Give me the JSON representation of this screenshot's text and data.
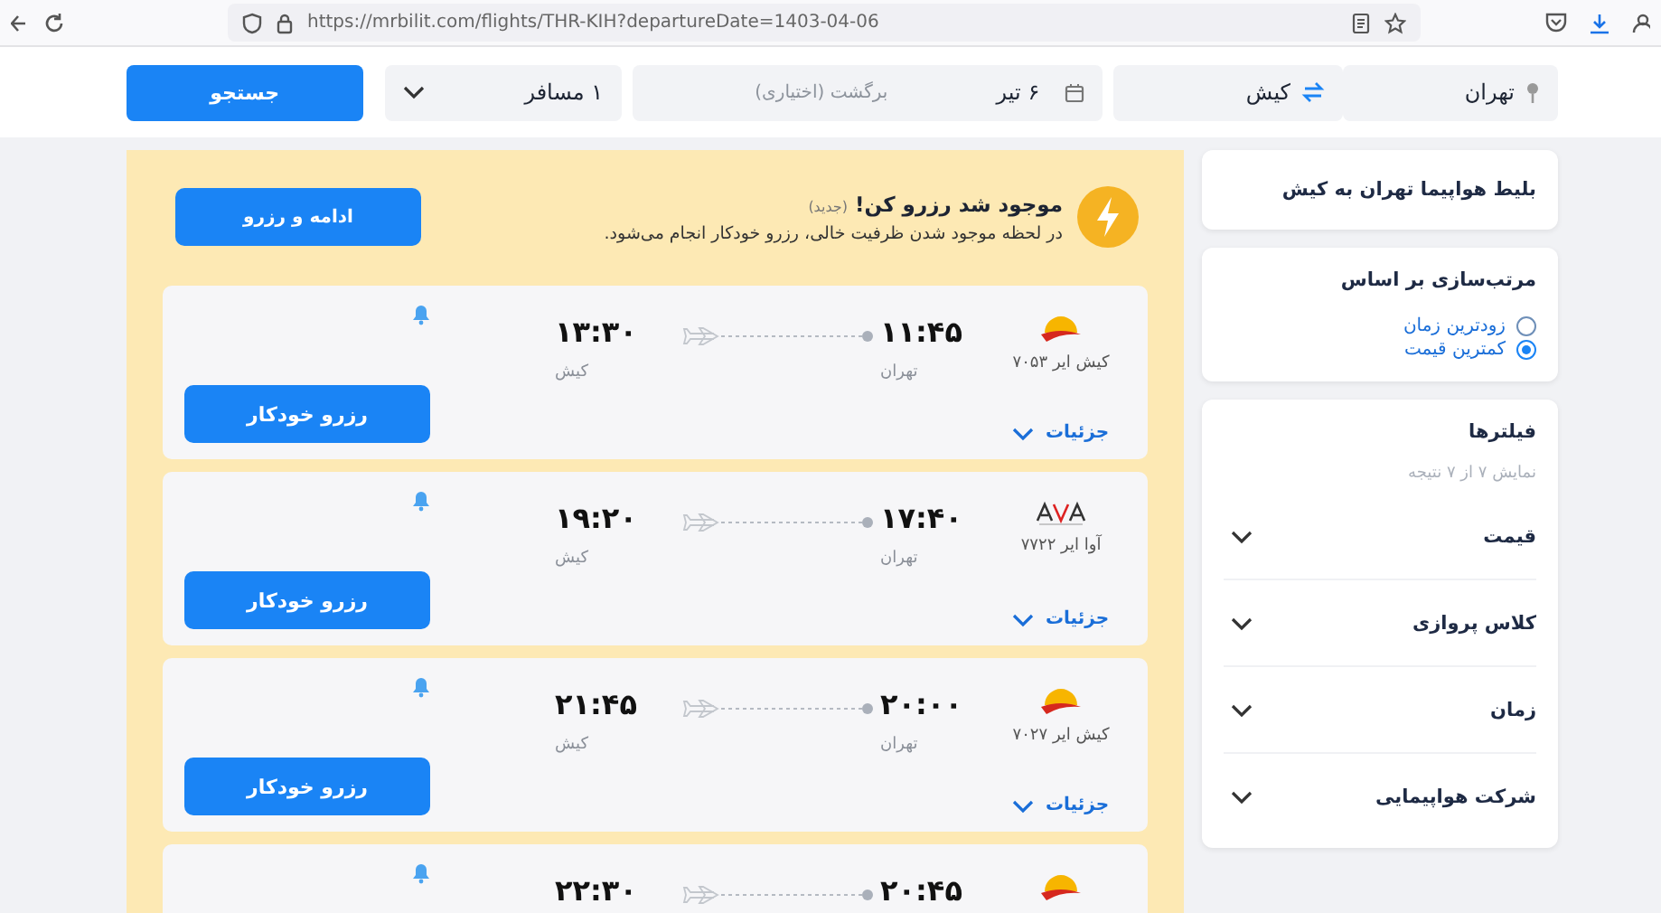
{
  "browser": {
    "url": "https://mrbilit.com/flights/THR-KIH?departureDate=1403-04-06"
  },
  "search": {
    "origin": "تهران",
    "destination": "کیش",
    "departure": "۶ تیر",
    "return_placeholder": "برگشت (اختیاری)",
    "passengers": "۱ مسافر",
    "button": "جستجو"
  },
  "banner": {
    "title": "موجود شد رزرو کن!",
    "tag": "(جدید)",
    "description": "در لحظه موجود شدن ظرفیت خالی، رزرو خودکار انجام می‌شود.",
    "button": "ادامه و رزرو"
  },
  "flights": [
    {
      "kind": "kish",
      "airline": "کیش ایر ۷۰۵۳",
      "depart_time": "۱۱:۴۵",
      "depart_city": "تهران",
      "arrive_time": "۱۳:۳۰",
      "arrive_city": "کیش",
      "details": "جزئیات",
      "button": "رزرو خودکار"
    },
    {
      "kind": "ava",
      "airline": "آوا ایر ۷۷۲۲",
      "depart_time": "۱۷:۴۰",
      "depart_city": "تهران",
      "arrive_time": "۱۹:۲۰",
      "arrive_city": "کیش",
      "details": "جزئیات",
      "button": "رزرو خودکار"
    },
    {
      "kind": "kish",
      "airline": "کیش ایر ۷۰۲۷",
      "depart_time": "۲۰:۰۰",
      "depart_city": "تهران",
      "arrive_time": "۲۱:۴۵",
      "arrive_city": "کیش",
      "details": "جزئیات",
      "button": "رزرو خودکار"
    },
    {
      "kind": "kish",
      "depart_time": "۲۰:۴۵",
      "arrive_time": "۲۲:۳۰"
    }
  ],
  "sidebar": {
    "title": "بلیط هواپیما تهران به کیش",
    "sort": {
      "title": "مرتب‌سازی بر اساس",
      "options": [
        {
          "label": "زودترین زمان",
          "selected": false
        },
        {
          "label": "کمترین قیمت",
          "selected": true
        }
      ]
    },
    "filters": {
      "title": "فیلترها",
      "count": "نمایش ۷ از ۷ نتیجه",
      "items": [
        {
          "label": "قیمت",
          "expanded": false
        },
        {
          "label": "کلاس پروازی",
          "expanded": false
        },
        {
          "label": "زمان",
          "expanded": false
        },
        {
          "label": "شرکت هواپیمایی",
          "expanded": false
        }
      ]
    }
  }
}
